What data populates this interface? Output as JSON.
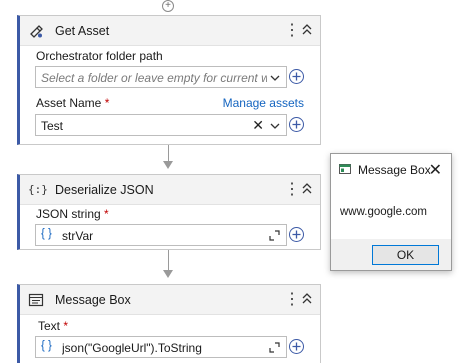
{
  "activities": [
    {
      "title": "Get Asset",
      "icon": "asset-icon",
      "folder_label": "Orchestrator folder path",
      "folder_placeholder": "Select a folder or leave empty for current worksp",
      "asset_label": "Asset Name",
      "required_mark": "*",
      "manage_link": "Manage assets",
      "asset_value": "Test"
    },
    {
      "title": "Deserialize JSON",
      "icon": "json-icon",
      "field_label": "JSON string",
      "required_mark": "*",
      "value": "strVar"
    },
    {
      "title": "Message Box",
      "icon": "message-box-icon",
      "field_label": "Text",
      "required_mark": "*",
      "value": "json(\"GoogleUrl\").ToString"
    }
  ],
  "expression_prefix": "{ }",
  "more_glyph": "⋮",
  "dialog": {
    "title": "Message Box",
    "message": "www.google.com",
    "ok_label": "OK",
    "close_glyph": "✕"
  },
  "colors": {
    "accent": "#3c5aa6",
    "link": "#1565c0",
    "required": "#c00000",
    "ok_border": "#0078d7"
  }
}
